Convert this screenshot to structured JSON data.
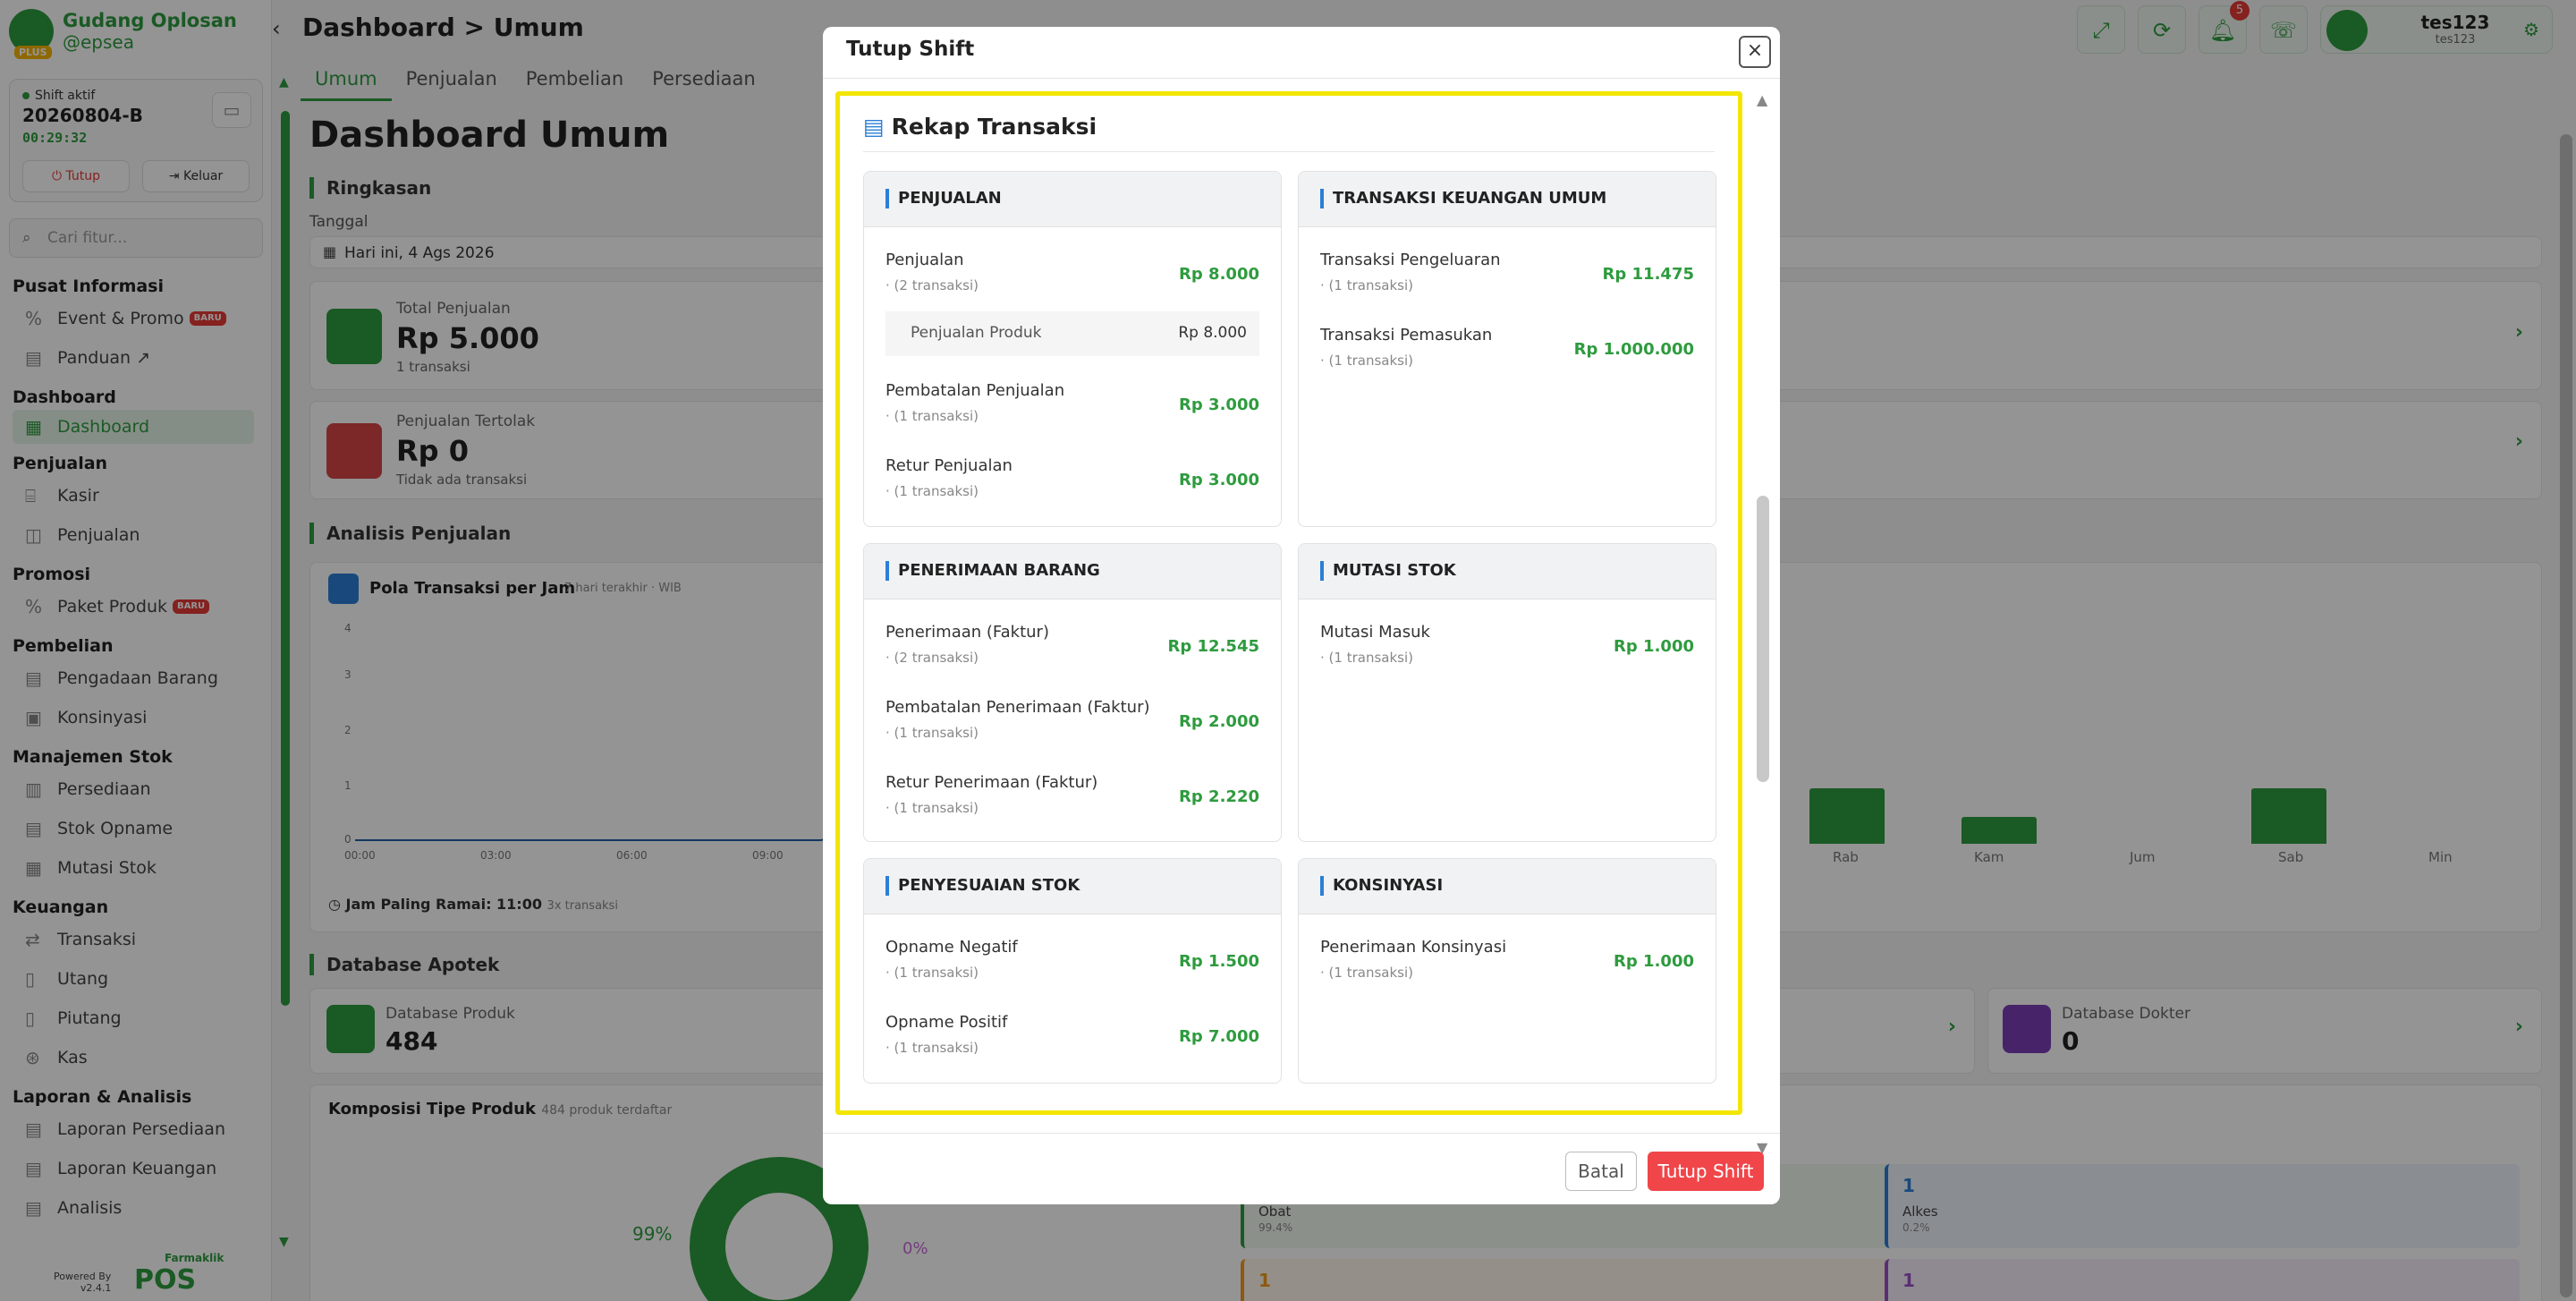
{
  "brand": {
    "name": "Gudang Oplosan",
    "handle": "@epsea",
    "tier": "PLUS"
  },
  "shift": {
    "label": "Shift aktif",
    "id": "20260804-B",
    "elapsed": "00:29:32",
    "tutup_label": "Tutup",
    "keluar_label": "Keluar"
  },
  "search": {
    "placeholder": "Cari fitur..."
  },
  "sidebar": {
    "pusat": {
      "title": "Pusat Informasi",
      "event": "Event & Promo",
      "event_badge": "BARU",
      "panduan": "Panduan"
    },
    "dashboard": {
      "title": "Dashboard",
      "item": "Dashboard"
    },
    "penjualan": {
      "title": "Penjualan",
      "kasir": "Kasir",
      "penjualan": "Penjualan"
    },
    "promosi": {
      "title": "Promosi",
      "paket": "Paket Produk",
      "paket_badge": "BARU"
    },
    "pembelian": {
      "title": "Pembelian",
      "pengadaan": "Pengadaan Barang",
      "konsinyasi": "Konsinyasi"
    },
    "stok": {
      "title": "Manajemen Stok",
      "persediaan": "Persediaan",
      "opname": "Stok Opname",
      "mutasi": "Mutasi Stok"
    },
    "keuangan": {
      "title": "Keuangan",
      "transaksi": "Transaksi",
      "utang": "Utang",
      "piutang": "Piutang",
      "kas": "Kas"
    },
    "laporan": {
      "title": "Laporan & Analisis",
      "persediaan": "Laporan Persediaan",
      "keuangan": "Laporan Keuangan",
      "analisis": "Analisis"
    }
  },
  "powered": {
    "label": "Powered By",
    "version": "v2.4.1",
    "logo_top": "Farmaklik",
    "logo": "POS"
  },
  "header": {
    "breadcrumb": "Dashboard > Umum",
    "notif_count": "5",
    "user": "tes123",
    "user_sub": "tes123"
  },
  "tabs": [
    "Umum",
    "Penjualan",
    "Pembelian",
    "Persediaan"
  ],
  "dashboard": {
    "title": "Dashboard Umum",
    "ringkasan": "Ringkasan",
    "tanggal_label": "Tanggal",
    "tanggal_value": "Hari ini, 4 Ags 2026",
    "total_label": "Total Penjualan",
    "total_value": "Rp 5.000",
    "total_sub": "1 transaksi",
    "tolak_label": "Penjualan Tertolak",
    "tolak_value": "Rp 0",
    "tolak_sub": "Tidak ada transaksi",
    "analisis": "Analisis Penjualan",
    "pola_title": "Pola Transaksi per Jam",
    "pola_sub": "7 hari terakhir · WIB",
    "jam_ramai": "Jam Paling Ramai: 11:00",
    "jam_ramai_sub": "3x transaksi",
    "y_ticks": [
      "4",
      "3",
      "2",
      "1",
      "0"
    ],
    "x_ticks": [
      "00:00",
      "03:00",
      "06:00",
      "09:00"
    ],
    "days": [
      "Rab",
      "Kam",
      "Jum",
      "Sab",
      "Min"
    ],
    "database": "Database Apotek",
    "db_produk_label": "Database Produk",
    "db_produk_value": "484",
    "db_dokter_label": "Database Dokter",
    "db_dokter_value": "0",
    "komposisi": "Komposisi Tipe Produk",
    "komposisi_sub": "484 produk terdaftar",
    "donut_pct": "99%",
    "donut_small": "0%",
    "obat_label": "Obat",
    "obat_pct": "99.4%",
    "alkes_count": "1",
    "alkes_label": "Alkes",
    "alkes_pct": "0.2%",
    "row2_count_a": "1",
    "row2_count_b": "1"
  },
  "modal": {
    "title": "Tutup Shift",
    "close": "×",
    "rekap_title": "Rekap Transaksi",
    "cards": {
      "penjualan": {
        "title": "PENJUALAN",
        "rows": [
          {
            "label": "Penjualan",
            "count": "· (2 transaksi)",
            "value": "Rp 8.000"
          },
          {
            "label": "Pembatalan Penjualan",
            "count": "· (1 transaksi)",
            "value": "Rp 3.000"
          },
          {
            "label": "Retur Penjualan",
            "count": "· (1 transaksi)",
            "value": "Rp 3.000"
          }
        ],
        "sub": {
          "label": "Penjualan Produk",
          "value": "Rp 8.000"
        }
      },
      "keuangan": {
        "title": "TRANSAKSI KEUANGAN UMUM",
        "rows": [
          {
            "label": "Transaksi Pengeluaran",
            "count": "· (1 transaksi)",
            "value": "Rp 11.475"
          },
          {
            "label": "Transaksi Pemasukan",
            "count": "· (1 transaksi)",
            "value": "Rp 1.000.000"
          }
        ]
      },
      "penerimaan": {
        "title": "PENERIMAAN BARANG",
        "rows": [
          {
            "label": "Penerimaan (Faktur)",
            "count": "· (2 transaksi)",
            "value": "Rp 12.545"
          },
          {
            "label": "Pembatalan Penerimaan (Faktur)",
            "count": "· (1 transaksi)",
            "value": "Rp 2.000"
          },
          {
            "label": "Retur Penerimaan (Faktur)",
            "count": "· (1 transaksi)",
            "value": "Rp 2.220"
          }
        ]
      },
      "mutasi": {
        "title": "MUTASI STOK",
        "rows": [
          {
            "label": "Mutasi Masuk",
            "count": "· (1 transaksi)",
            "value": "Rp 1.000"
          }
        ]
      },
      "penyesuaian": {
        "title": "PENYESUAIAN STOK",
        "rows": [
          {
            "label": "Opname Negatif",
            "count": "· (1 transaksi)",
            "value": "Rp 1.500"
          },
          {
            "label": "Opname Positif",
            "count": "· (1 transaksi)",
            "value": "Rp 7.000"
          }
        ]
      },
      "konsinyasi": {
        "title": "KONSINYASI",
        "rows": [
          {
            "label": "Penerimaan Konsinyasi",
            "count": "· (1 transaksi)",
            "value": "Rp 1.000"
          }
        ]
      }
    },
    "batal_label": "Batal",
    "tutup_label": "Tutup Shift"
  },
  "colors": {
    "brand_green": "#2e9b3e",
    "danger": "#f0464a",
    "accent_blue": "#2b7fd6",
    "highlight": "#f2e600"
  }
}
